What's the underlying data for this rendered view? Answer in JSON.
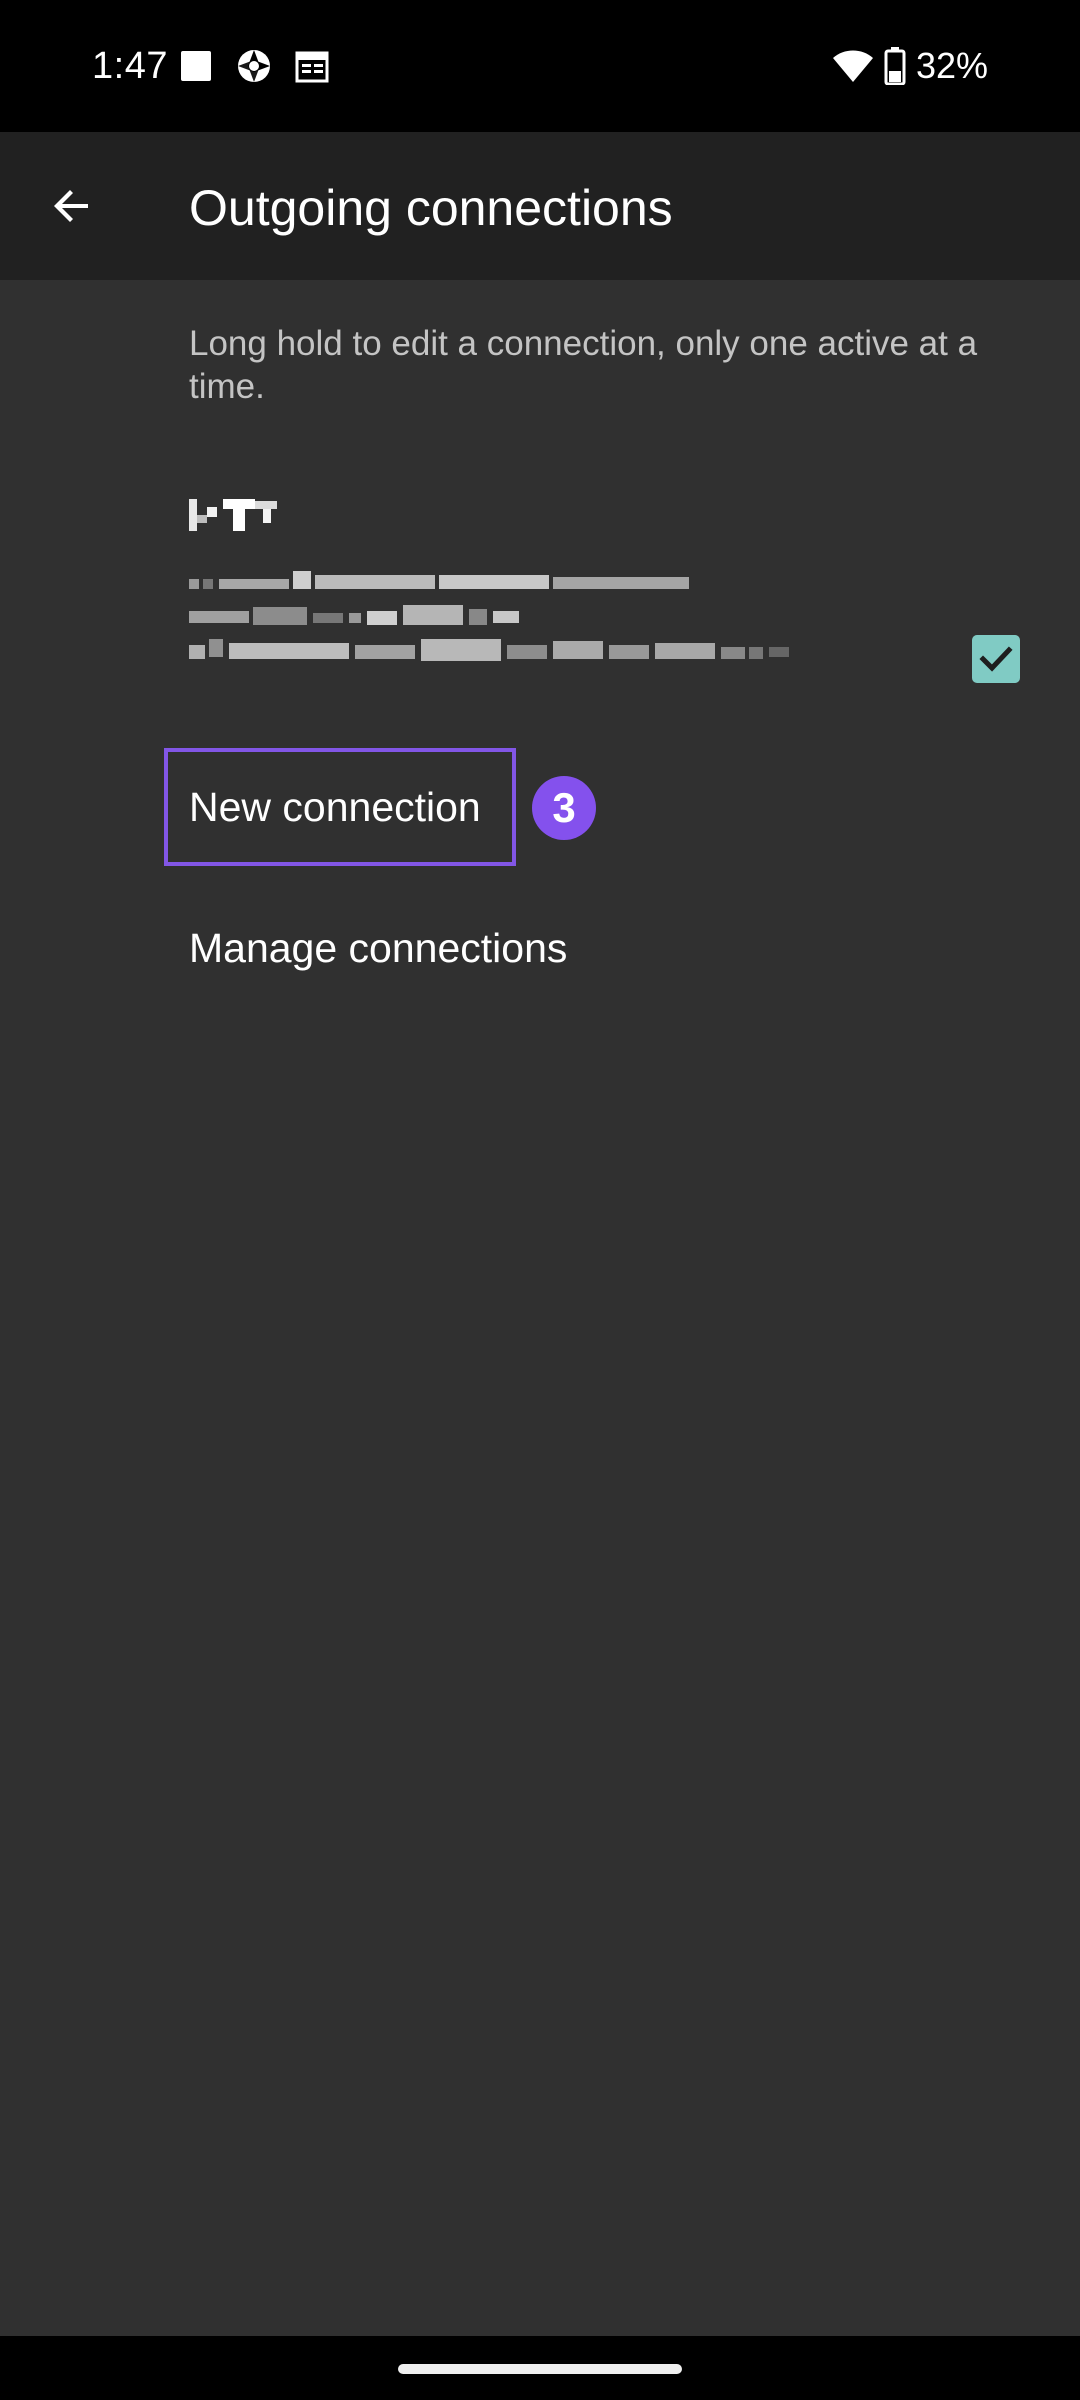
{
  "status_bar": {
    "time": "1:47",
    "battery_percent": "32%",
    "icons": [
      "square-notification-icon",
      "aperture-icon",
      "calendar-icon",
      "wifi-icon",
      "battery-icon"
    ]
  },
  "app_bar": {
    "title": "Outgoing connections",
    "back_icon": "arrow-back-icon"
  },
  "content": {
    "hint": "Long hold to edit a connection, only one active at a time.",
    "connection": {
      "checked": true,
      "check_color": "#80cbc4"
    },
    "new_connection_label": "New connection",
    "manage_connections_label": "Manage connections",
    "step_badge": "3",
    "highlight_color": "#8256e6"
  },
  "colors": {
    "appbar_bg": "#212121",
    "content_bg": "#303030",
    "hint_text": "#c4c4c4",
    "badge": "#8451ed"
  }
}
